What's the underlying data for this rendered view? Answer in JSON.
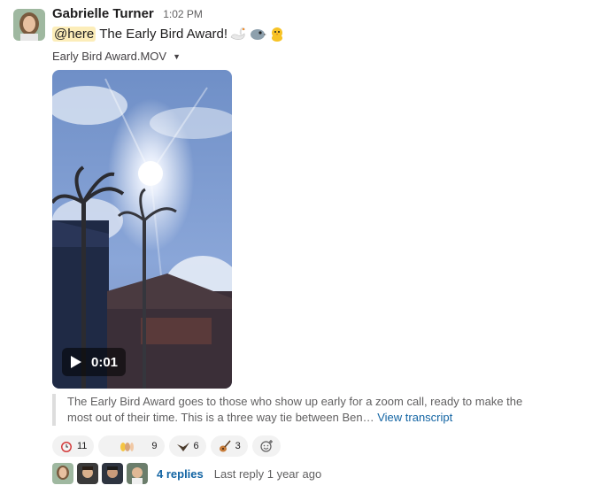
{
  "message": {
    "author": "Gabrielle Turner",
    "time": "1:02 PM",
    "mention": "@here",
    "text": "The Early Bird Award!",
    "emojis": [
      "swan-emoji",
      "bird-emoji",
      "chick-emoji"
    ]
  },
  "attachment": {
    "filename": "Early Bird Award.MOV",
    "duration": "0:01"
  },
  "transcript": {
    "text": "The Early Bird Award goes to those who show up early for a zoom call, ready to make the most out of their time. This is a three way tie between Ben…",
    "link": "View transcript"
  },
  "reactions": [
    {
      "icon": "alarm-clock-emoji",
      "count": "11"
    },
    {
      "icon": "waving-hands-emoji",
      "count": "9"
    },
    {
      "icon": "eagle-emoji",
      "count": "6"
    },
    {
      "icon": "guitar-emoji",
      "count": "3"
    }
  ],
  "thread": {
    "replies": "4 replies",
    "last_reply": "Last reply 1 year ago"
  },
  "colors": {
    "mention_bg": "#fcedb9",
    "link": "#1264a3"
  }
}
